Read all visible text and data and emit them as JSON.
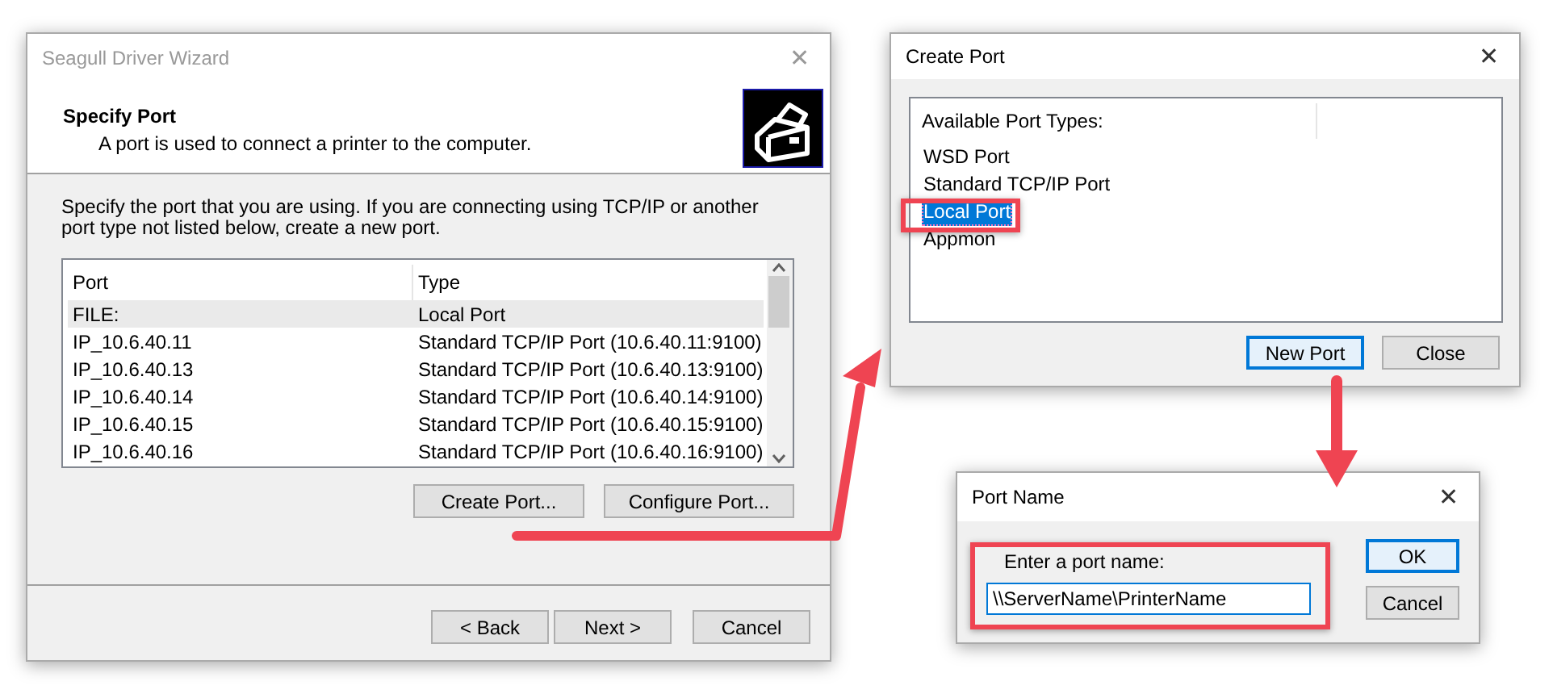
{
  "wizard": {
    "title": "Seagull Driver Wizard",
    "active": false,
    "close": "✕",
    "header": {
      "title": "Specify Port",
      "subtitle": "A port is used to connect a printer to the computer."
    },
    "instructions": "Specify the port that you are using.  If you are connecting using TCP/IP or another port type not listed below, create a new port.",
    "ports": {
      "columns": [
        "Port",
        "Type"
      ],
      "rows": [
        {
          "port": "FILE:",
          "type": "Local Port",
          "selected": true
        },
        {
          "port": "IP_10.6.40.11",
          "type": "Standard TCP/IP Port (10.6.40.11:9100)",
          "selected": false
        },
        {
          "port": "IP_10.6.40.13",
          "type": "Standard TCP/IP Port (10.6.40.13:9100)",
          "selected": false
        },
        {
          "port": "IP_10.6.40.14",
          "type": "Standard TCP/IP Port (10.6.40.14:9100)",
          "selected": false
        },
        {
          "port": "IP_10.6.40.15",
          "type": "Standard TCP/IP Port (10.6.40.15:9100)",
          "selected": false
        },
        {
          "port": "IP_10.6.40.16",
          "type": "Standard TCP/IP Port (10.6.40.16:9100)",
          "selected": false
        }
      ]
    },
    "port_buttons": [
      {
        "label": "Create Port...",
        "default": false
      },
      {
        "label": "Configure Port...",
        "default": false
      }
    ],
    "nav_buttons": [
      {
        "label": "< Back",
        "default": false
      },
      {
        "label": "Next >",
        "default": false
      },
      {
        "label": "Cancel",
        "default": false
      }
    ]
  },
  "create_port": {
    "title": "Create Port",
    "active": true,
    "close": "✕",
    "list_header": "Available Port Types:",
    "items": [
      {
        "label": "WSD Port",
        "selected": false
      },
      {
        "label": "Standard TCP/IP Port",
        "selected": false
      },
      {
        "label": "Local Port",
        "selected": true
      },
      {
        "label": "Appmon",
        "selected": false
      }
    ],
    "buttons": [
      {
        "label": "New Port",
        "default": true
      },
      {
        "label": "Close",
        "default": false
      }
    ]
  },
  "port_name": {
    "title": "Port Name",
    "active": true,
    "close": "✕",
    "prompt": "Enter a port name:",
    "value": "\\\\ServerName\\PrinterName",
    "buttons": [
      {
        "label": "OK",
        "default": true
      },
      {
        "label": "Cancel",
        "default": false
      }
    ]
  }
}
